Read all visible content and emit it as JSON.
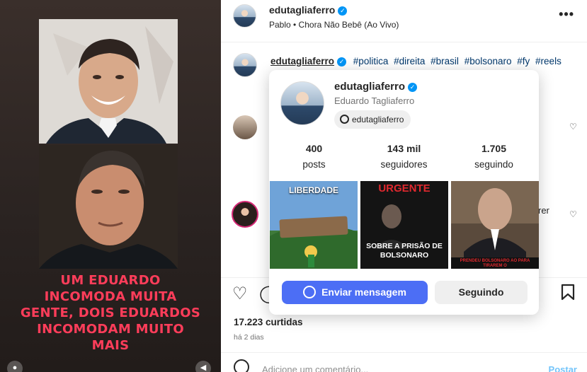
{
  "media": {
    "caption_lines": [
      "UM EDUARDO",
      "INCOMODA MUITA",
      "GENTE, DOIS EDUARDOS",
      "INCOMODAM MUITO",
      "MAIS"
    ],
    "caption_color": "#ff3d5a"
  },
  "post": {
    "username": "edutagliaferro",
    "audio": "Pablo • Chora Não Bebê (Ao Vivo)",
    "more_icon": "more-horizontal-icon",
    "caption": {
      "username": "edutagliaferro",
      "hashtags": [
        "#politica",
        "#direita",
        "#brasil",
        "#bolsonaro",
        "#fy",
        "#reels"
      ]
    },
    "partial_comment_text": "rer",
    "likes": "17.223 curtidas",
    "time": "há 2 dias",
    "comment_placeholder": "Adicione um comentário...",
    "post_button": "Postar"
  },
  "hover_card": {
    "username": "edutagliaferro",
    "full_name": "Eduardo Tagliaferro",
    "threads_handle": "edutagliaferro",
    "stats": [
      {
        "value": "400",
        "label": "posts"
      },
      {
        "value": "143 mil",
        "label": "seguidores"
      },
      {
        "value": "1.705",
        "label": "seguindo"
      }
    ],
    "tiles": [
      {
        "title": "LIBERDADE",
        "subtitle": ""
      },
      {
        "title": "URGENTE",
        "subtitle": "SOBRE A PRISÃO DE BOLSONARO"
      },
      {
        "title": "",
        "subtitle": "PRENDEU BOLSONARO AO PARA TIRAREM O"
      }
    ],
    "message_button": "Enviar mensagem",
    "following_button": "Seguindo"
  },
  "colors": {
    "accent_blue": "#4c6ef5",
    "link_blue": "#00376b",
    "verified_blue": "#0095f6"
  }
}
